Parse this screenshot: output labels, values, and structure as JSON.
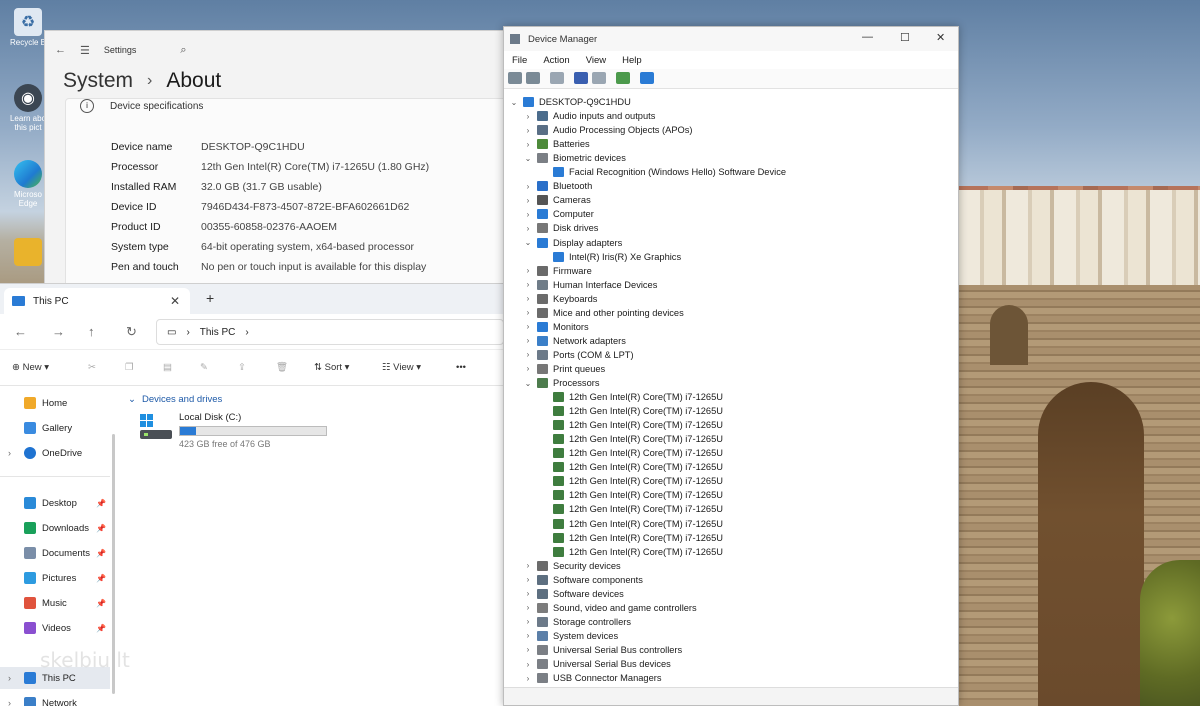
{
  "desktop": {
    "icons": [
      {
        "label": "Recycle B",
        "icon": "recycle-bin-icon"
      },
      {
        "label": "Learn abo this pict",
        "icon": "learn-icon"
      },
      {
        "label": "Microso Edge",
        "icon": "edge-icon"
      },
      {
        "label": "",
        "icon": "user-folder-icon"
      }
    ]
  },
  "settings": {
    "window_label": "Settings",
    "breadcrumb_parent": "System",
    "breadcrumb_sep": "›",
    "page_title": "About",
    "section_title": "Device specifications",
    "specs": [
      {
        "key": "Device name",
        "value": "DESKTOP-Q9C1HDU"
      },
      {
        "key": "Processor",
        "value": "12th Gen Intel(R) Core(TM) i7-1265U (1.80 GHz)"
      },
      {
        "key": "Installed RAM",
        "value": "32.0 GB (31.7 GB usable)"
      },
      {
        "key": "Device ID",
        "value": "7946D434-F873-4507-872E-BFA602661D62"
      },
      {
        "key": "Product ID",
        "value": "00355-60858-02376-AAOEM"
      },
      {
        "key": "System type",
        "value": "64-bit operating system, x64-based processor"
      },
      {
        "key": "Pen and touch",
        "value": "No pen or touch input is available for this display"
      }
    ]
  },
  "explorer": {
    "tab_label": "This PC",
    "address": "This PC",
    "commands": {
      "new": "New",
      "sort": "Sort",
      "view": "View"
    },
    "nav": {
      "home": "Home",
      "gallery": "Gallery",
      "onedrive": "OneDrive",
      "desktop": "Desktop",
      "downloads": "Downloads",
      "documents": "Documents",
      "pictures": "Pictures",
      "music": "Music",
      "videos": "Videos",
      "thispc": "This PC",
      "network": "Network"
    },
    "group_label": "Devices and drives",
    "drive": {
      "name": "Local Disk (C:)",
      "free_text": "423 GB free of 476 GB",
      "used_fraction": 0.111
    }
  },
  "watermark": "skelbiu.lt",
  "devmgr": {
    "title": "Device Manager",
    "menu": [
      "File",
      "Action",
      "View",
      "Help"
    ],
    "root": "DESKTOP-Q9C1HDU",
    "categories": [
      {
        "label": "Audio inputs and outputs",
        "expanded": false
      },
      {
        "label": "Audio Processing Objects (APOs)",
        "expanded": false
      },
      {
        "label": "Batteries",
        "expanded": false
      },
      {
        "label": "Biometric devices",
        "expanded": true,
        "children": [
          "Facial Recognition (Windows Hello) Software Device"
        ]
      },
      {
        "label": "Bluetooth",
        "expanded": false
      },
      {
        "label": "Cameras",
        "expanded": false
      },
      {
        "label": "Computer",
        "expanded": false
      },
      {
        "label": "Disk drives",
        "expanded": false
      },
      {
        "label": "Display adapters",
        "expanded": true,
        "children": [
          "Intel(R) Iris(R) Xe Graphics"
        ]
      },
      {
        "label": "Firmware",
        "expanded": false
      },
      {
        "label": "Human Interface Devices",
        "expanded": false
      },
      {
        "label": "Keyboards",
        "expanded": false
      },
      {
        "label": "Mice and other pointing devices",
        "expanded": false
      },
      {
        "label": "Monitors",
        "expanded": false
      },
      {
        "label": "Network adapters",
        "expanded": false
      },
      {
        "label": "Ports (COM & LPT)",
        "expanded": false
      },
      {
        "label": "Print queues",
        "expanded": false
      },
      {
        "label": "Processors",
        "expanded": true,
        "children": [
          "12th Gen Intel(R) Core(TM) i7-1265U",
          "12th Gen Intel(R) Core(TM) i7-1265U",
          "12th Gen Intel(R) Core(TM) i7-1265U",
          "12th Gen Intel(R) Core(TM) i7-1265U",
          "12th Gen Intel(R) Core(TM) i7-1265U",
          "12th Gen Intel(R) Core(TM) i7-1265U",
          "12th Gen Intel(R) Core(TM) i7-1265U",
          "12th Gen Intel(R) Core(TM) i7-1265U",
          "12th Gen Intel(R) Core(TM) i7-1265U",
          "12th Gen Intel(R) Core(TM) i7-1265U",
          "12th Gen Intel(R) Core(TM) i7-1265U",
          "12th Gen Intel(R) Core(TM) i7-1265U"
        ]
      },
      {
        "label": "Security devices",
        "expanded": false
      },
      {
        "label": "Software components",
        "expanded": false
      },
      {
        "label": "Software devices",
        "expanded": false
      },
      {
        "label": "Sound, video and game controllers",
        "expanded": false
      },
      {
        "label": "Storage controllers",
        "expanded": false
      },
      {
        "label": "System devices",
        "expanded": false
      },
      {
        "label": "Universal Serial Bus controllers",
        "expanded": false
      },
      {
        "label": "Universal Serial Bus devices",
        "expanded": false
      },
      {
        "label": "USB Connector Managers",
        "expanded": false
      }
    ]
  },
  "colors": {
    "accent": "#2a7bd5",
    "link": "#1e5aa8"
  }
}
